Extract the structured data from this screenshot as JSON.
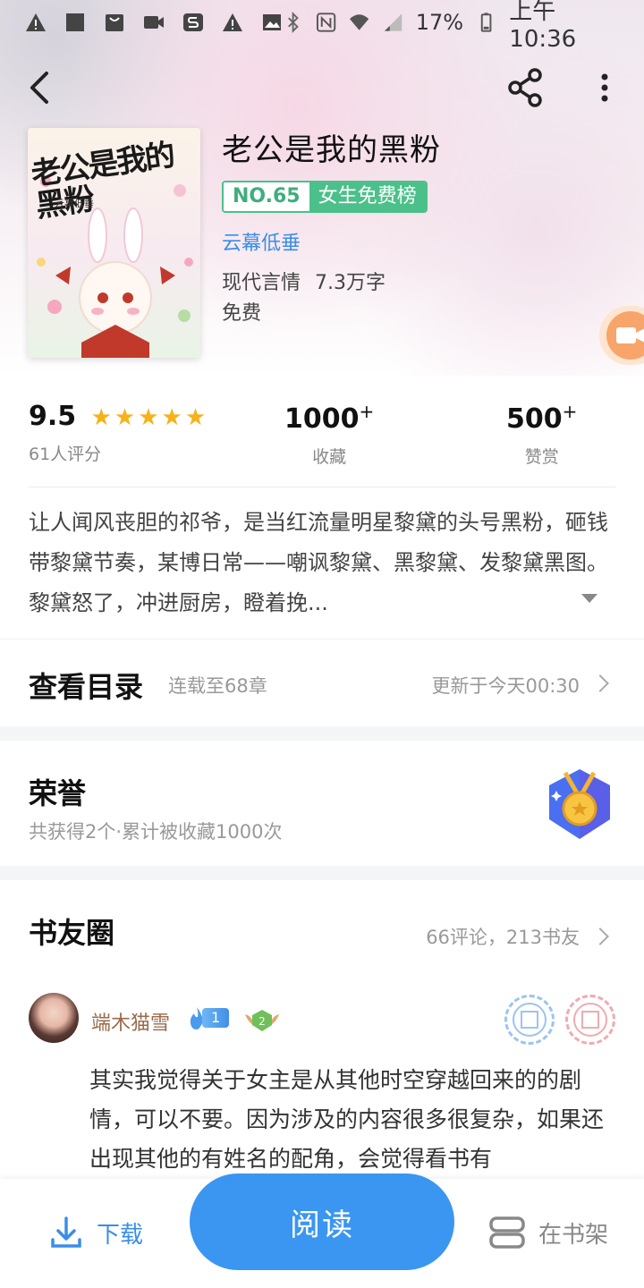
{
  "status_bar": {
    "battery": "17%",
    "time": "上午10:36"
  },
  "book": {
    "title": "老公是我的黑粉",
    "rank_no": "NO.65",
    "rank_list": "女生免费榜",
    "author": "云幕低垂",
    "genre": "现代言情",
    "word_count": "7.3万字",
    "price": "免费",
    "cover_title": "老公是我的黑粉",
    "cover_author": "云幕低垂"
  },
  "stats": {
    "score": "9.5",
    "rating_stars": 5,
    "raters": "61人评分",
    "favorites": "1000",
    "favorites_label": "收藏",
    "rewards": "500",
    "rewards_label": "赞赏",
    "plus": "+"
  },
  "description": "让人闻风丧胆的祁爷，是当红流量明星黎黛的头号黑粉，砸钱带黎黛节奏，某博日常——嘲讽黎黛、黑黎黛、发黎黛黑图。黎黛怒了，冲进厨房，瞪着挽...",
  "toc": {
    "title": "查看目录",
    "progress": "连载至68章",
    "updated": "更新于今天00:30"
  },
  "honor": {
    "title": "荣誉",
    "summary": "共获得2个·累计被收藏1000次"
  },
  "circle": {
    "title": "书友圈",
    "stats": "66评论，213书友",
    "comment": {
      "user": "端木猫雪",
      "fan_level": "1",
      "wing_level": "2",
      "text": "其实我觉得关于女主是从其他时空穿越回来的的剧情，可以不要。因为涉及的内容很多很复杂，如果还出现其他的有姓名的配角，会觉得看书有"
    }
  },
  "bottom_bar": {
    "download": "下载",
    "read": "阅读",
    "shelf": "在书架"
  },
  "colors": {
    "accent_blue": "#3a96f0",
    "rank_green": "#4cc08a",
    "star_gold": "#f6b21a"
  }
}
